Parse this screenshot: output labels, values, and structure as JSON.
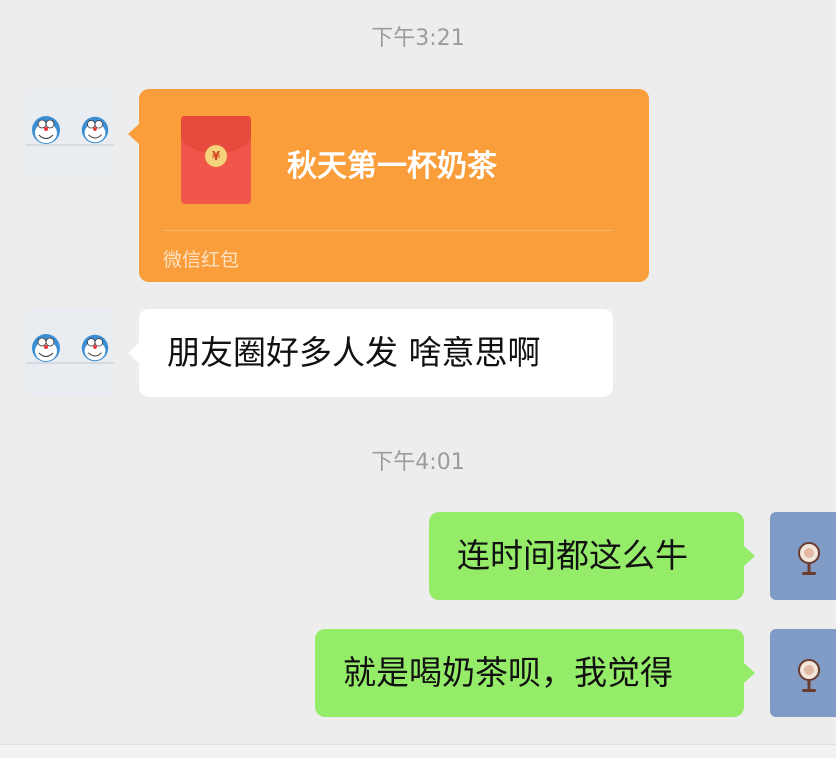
{
  "timestamps": [
    "下午3:21",
    "下午4:01"
  ],
  "red_packet": {
    "title": "秋天第一杯奶茶",
    "caption": "微信红包",
    "icon": "red-envelope-icon",
    "coin_symbol": "¥"
  },
  "messages": {
    "incoming_text": "朋友圈好多人发 啥意思啊",
    "outgoing_1": "连时间都这么牛",
    "outgoing_2": "就是喝奶茶呗，我觉得"
  },
  "colors": {
    "background": "#ededed",
    "incoming_bubble": "#ffffff",
    "outgoing_bubble": "#95ec69",
    "red_packet": "#fa9d3b"
  }
}
